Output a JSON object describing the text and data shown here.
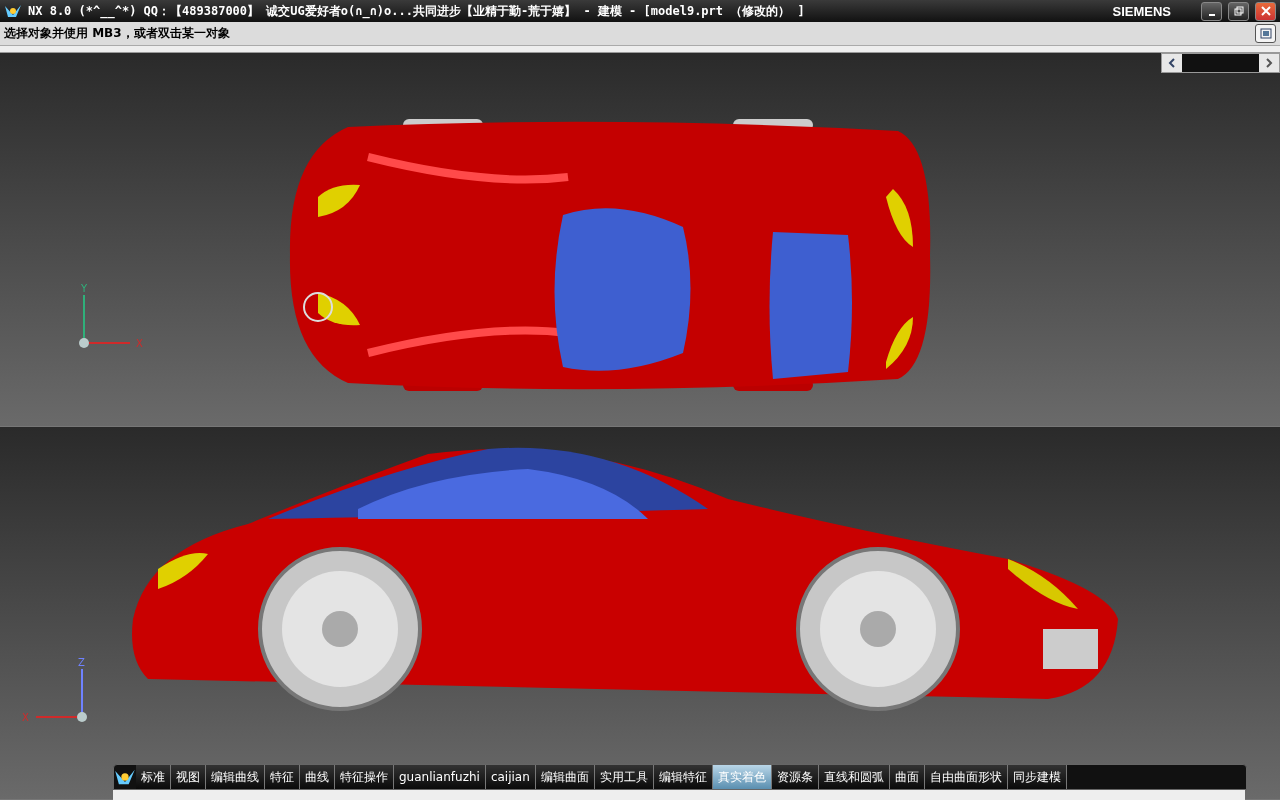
{
  "window": {
    "title": "NX 8.0 (*^__^*) QQ：【489387000】 诚交UG爱好者o(∩_∩)o...共同进步【业精于勤-荒于嬉】 - 建模 - [model9.prt （修改的） ]",
    "brand": "SIEMENS"
  },
  "cue_line": "选择对象并使用 MB3，或者双击某一对象",
  "viewports": [
    {
      "kind": "top",
      "axes": [
        {
          "kind": "vertical",
          "label": "Y"
        },
        {
          "kind": "horizontal",
          "label": "X"
        }
      ]
    },
    {
      "kind": "side",
      "axes": [
        {
          "kind": "vertical",
          "label": "Z"
        },
        {
          "kind": "horizontal",
          "label": "X"
        }
      ]
    }
  ],
  "toolbar_tabs": [
    {
      "label": "标准",
      "selected": false
    },
    {
      "label": "视图",
      "selected": false
    },
    {
      "label": "编辑曲线",
      "selected": false
    },
    {
      "label": "特征",
      "selected": false
    },
    {
      "label": "曲线",
      "selected": false
    },
    {
      "label": "特征操作",
      "selected": false
    },
    {
      "label": "guanlianfuzhi",
      "selected": false
    },
    {
      "label": "caijian",
      "selected": false
    },
    {
      "label": "编辑曲面",
      "selected": false
    },
    {
      "label": "实用工具",
      "selected": false
    },
    {
      "label": "编辑特征",
      "selected": false
    },
    {
      "label": "真实着色",
      "selected": true
    },
    {
      "label": "资源条",
      "selected": false
    },
    {
      "label": "直线和圆弧",
      "selected": false
    },
    {
      "label": "曲面",
      "selected": false
    },
    {
      "label": "自由曲面形状",
      "selected": false
    },
    {
      "label": "同步建模",
      "selected": false
    }
  ]
}
